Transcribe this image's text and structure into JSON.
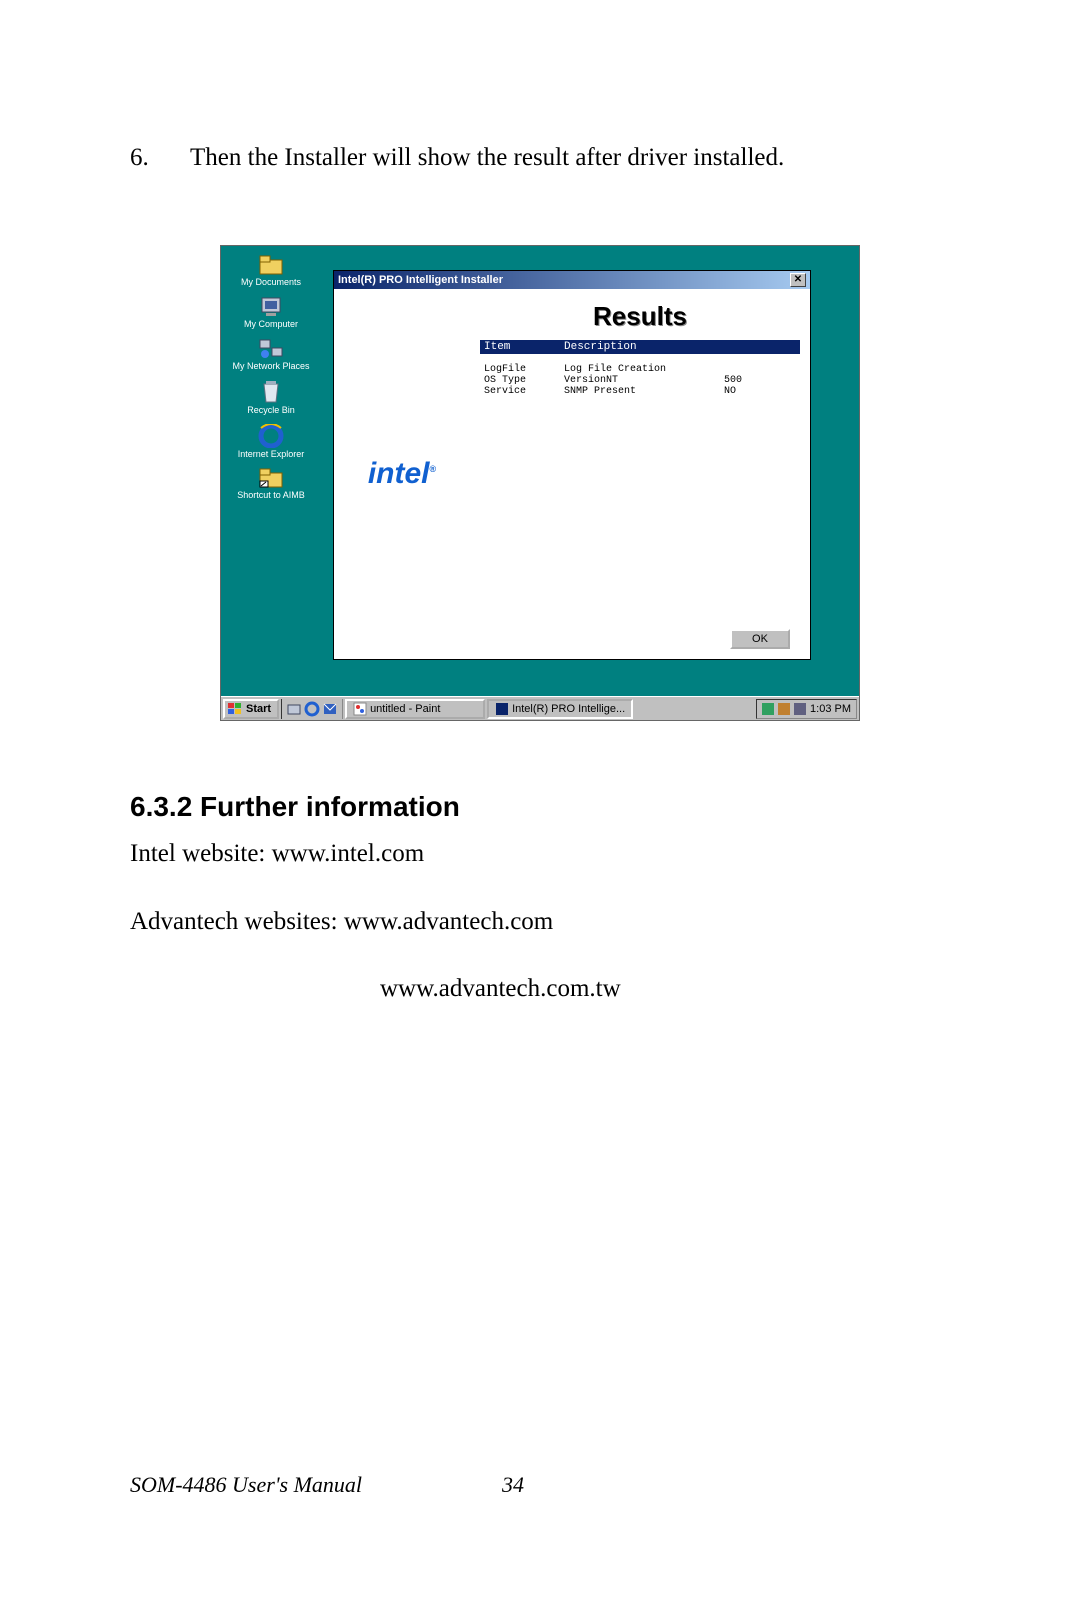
{
  "step": {
    "number": "6.",
    "text": "Then the Installer will show the result after driver installed."
  },
  "desktop": {
    "icons": [
      {
        "label": "My Documents"
      },
      {
        "label": "My Computer"
      },
      {
        "label": "My Network Places"
      },
      {
        "label": "Recycle Bin"
      },
      {
        "label": "Internet Explorer"
      },
      {
        "label": "Shortcut to AIMB"
      }
    ]
  },
  "installer": {
    "title": "Intel(R) PRO Intelligent Installer",
    "close": "✕",
    "logo": "intel",
    "logo_r": "®",
    "results_header": "Results",
    "cols": {
      "item": "Item",
      "desc": "Description"
    },
    "rows": [
      {
        "item": "LogFile",
        "desc": "Log File Creation",
        "val": ""
      },
      {
        "item": "OS Type",
        "desc": "VersionNT",
        "val": "500"
      },
      {
        "item": "Service",
        "desc": "SNMP Present",
        "val": "NO"
      }
    ],
    "ok": "OK"
  },
  "taskbar": {
    "start": "Start",
    "task1": "untitled - Paint",
    "task2": "Intel(R) PRO Intellige...",
    "time": "1:03 PM"
  },
  "section": {
    "heading": "6.3.2 Further information",
    "p1": "Intel website: www.intel.com",
    "p2": "Advantech websites: www.advantech.com",
    "p3": "www.advantech.com.tw"
  },
  "footer": {
    "title": "SOM-4486 User's Manual",
    "page": "34"
  }
}
